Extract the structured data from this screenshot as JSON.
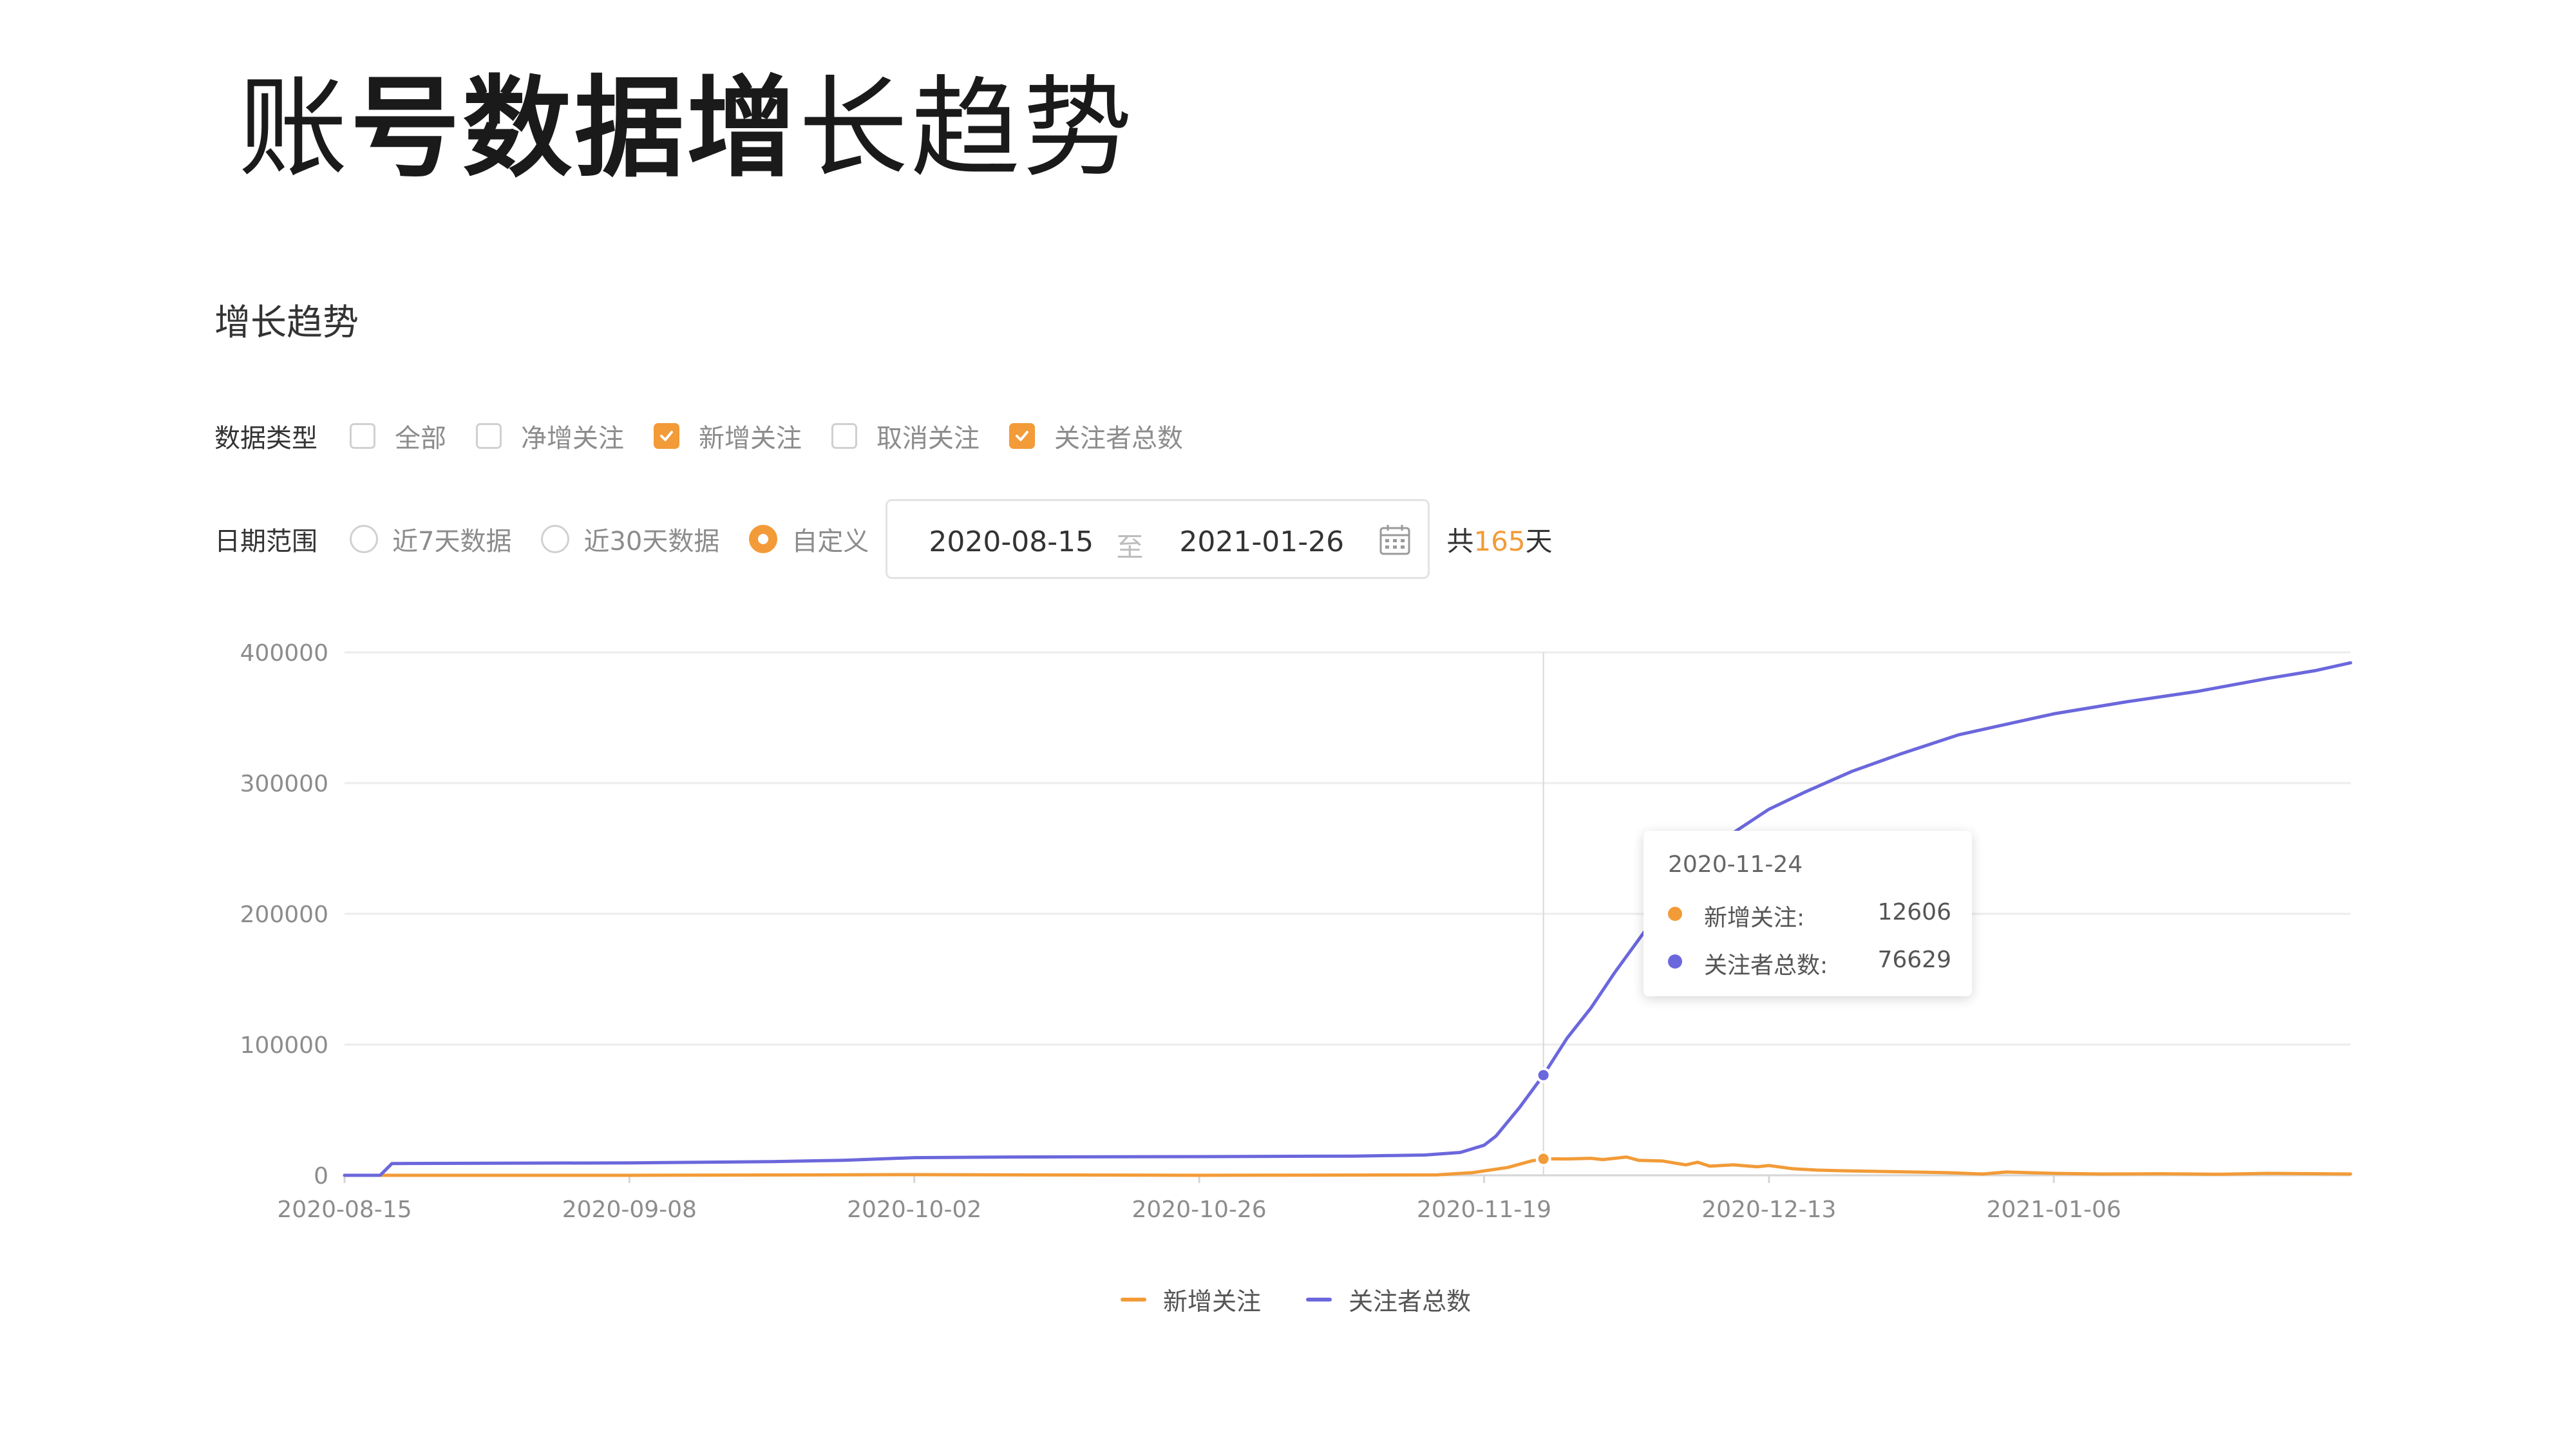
{
  "slide": {
    "title_part1": "账",
    "title_part2": "号数据增",
    "title_part3": "长趋势"
  },
  "section": {
    "title": "增长趋势"
  },
  "data_type": {
    "label": "数据类型",
    "options": [
      {
        "label": "全部",
        "checked": false
      },
      {
        "label": "净增关注",
        "checked": false
      },
      {
        "label": "新增关注",
        "checked": true
      },
      {
        "label": "取消关注",
        "checked": false
      },
      {
        "label": "关注者总数",
        "checked": true
      }
    ]
  },
  "date_range": {
    "label": "日期范围",
    "options": [
      {
        "label": "近7天数据",
        "selected": false
      },
      {
        "label": "近30天数据",
        "selected": false
      },
      {
        "label": "自定义",
        "selected": true
      }
    ],
    "start": "2020-08-15",
    "separator": "至",
    "end": "2021-01-26",
    "total_prefix": "共",
    "total_days": "165",
    "total_suffix": "天"
  },
  "colors": {
    "accent": "#f29b38",
    "new_follow": "#f29b38",
    "total_followers": "#6b67dc",
    "grid": "#ececec",
    "axis_text": "#8c8c8c"
  },
  "tooltip": {
    "date": "2020-11-24",
    "rows": [
      {
        "label": "新增关注:",
        "value": "12606"
      },
      {
        "label": "关注者总数:",
        "value": "76629"
      }
    ]
  },
  "chart_data": {
    "type": "line",
    "x_start": "2020-08-15",
    "x_end": "2021-01-31",
    "x_ticks": [
      "2020-08-15",
      "2020-09-08",
      "2020-10-02",
      "2020-10-26",
      "2020-11-19",
      "2020-12-13",
      "2021-01-06"
    ],
    "ylim": [
      0,
      400000
    ],
    "y_ticks": [
      0,
      100000,
      200000,
      300000,
      400000
    ],
    "y_tick_labels": [
      "0",
      "100000",
      "200000",
      "300000",
      "400000"
    ],
    "grid": true,
    "legend_position": "bottom-center",
    "crosshair_x": "2020-11-24",
    "series": [
      {
        "name": "新增关注",
        "color": "#f29b38",
        "points": [
          [
            "2020-08-15",
            0
          ],
          [
            "2020-09-08",
            0
          ],
          [
            "2020-10-02",
            500
          ],
          [
            "2020-10-26",
            0
          ],
          [
            "2020-11-15",
            300
          ],
          [
            "2020-11-18",
            2000
          ],
          [
            "2020-11-21",
            6000
          ],
          [
            "2020-11-23",
            11000
          ],
          [
            "2020-11-24",
            12606
          ],
          [
            "2020-11-26",
            12500
          ],
          [
            "2020-11-28",
            13000
          ],
          [
            "2020-11-29",
            12000
          ],
          [
            "2020-12-01",
            14000
          ],
          [
            "2020-12-02",
            11500
          ],
          [
            "2020-12-04",
            11000
          ],
          [
            "2020-12-06",
            8000
          ],
          [
            "2020-12-07",
            10000
          ],
          [
            "2020-12-08",
            7000
          ],
          [
            "2020-12-10",
            8000
          ],
          [
            "2020-12-12",
            6500
          ],
          [
            "2020-12-13",
            7500
          ],
          [
            "2020-12-15",
            5000
          ],
          [
            "2020-12-17",
            4000
          ],
          [
            "2020-12-19",
            3500
          ],
          [
            "2020-12-22",
            3000
          ],
          [
            "2020-12-25",
            2500
          ],
          [
            "2020-12-28",
            2000
          ],
          [
            "2020-12-31",
            1000
          ],
          [
            "2021-01-02",
            2500
          ],
          [
            "2021-01-06",
            1500
          ],
          [
            "2021-01-10",
            1000
          ],
          [
            "2021-01-15",
            1200
          ],
          [
            "2021-01-20",
            800
          ],
          [
            "2021-01-24",
            1500
          ],
          [
            "2021-01-31",
            1000
          ]
        ]
      },
      {
        "name": "关注者总数",
        "color": "#6b67dc",
        "points": [
          [
            "2020-08-15",
            0
          ],
          [
            "2020-08-18",
            0
          ],
          [
            "2020-08-19",
            9000
          ],
          [
            "2020-09-08",
            9500
          ],
          [
            "2020-09-20",
            10500
          ],
          [
            "2020-09-26",
            11500
          ],
          [
            "2020-10-02",
            13500
          ],
          [
            "2020-10-10",
            14000
          ],
          [
            "2020-10-26",
            14300
          ],
          [
            "2020-11-08",
            14700
          ],
          [
            "2020-11-14",
            15500
          ],
          [
            "2020-11-17",
            17500
          ],
          [
            "2020-11-19",
            23000
          ],
          [
            "2020-11-20",
            30000
          ],
          [
            "2020-11-22",
            52000
          ],
          [
            "2020-11-24",
            76629
          ],
          [
            "2020-11-26",
            105000
          ],
          [
            "2020-11-28",
            128000
          ],
          [
            "2020-11-30",
            155000
          ],
          [
            "2020-12-02",
            180000
          ],
          [
            "2020-12-04",
            205000
          ],
          [
            "2020-12-07",
            235000
          ],
          [
            "2020-12-10",
            262000
          ],
          [
            "2020-12-13",
            280000
          ],
          [
            "2020-12-16",
            293000
          ],
          [
            "2020-12-20",
            309000
          ],
          [
            "2020-12-24",
            322000
          ],
          [
            "2020-12-29",
            337000
          ],
          [
            "2021-01-01",
            343000
          ],
          [
            "2021-01-06",
            353000
          ],
          [
            "2021-01-12",
            362000
          ],
          [
            "2021-01-18",
            370000
          ],
          [
            "2021-01-24",
            380000
          ],
          [
            "2021-01-28",
            386000
          ],
          [
            "2021-01-31",
            392000
          ]
        ]
      }
    ]
  }
}
